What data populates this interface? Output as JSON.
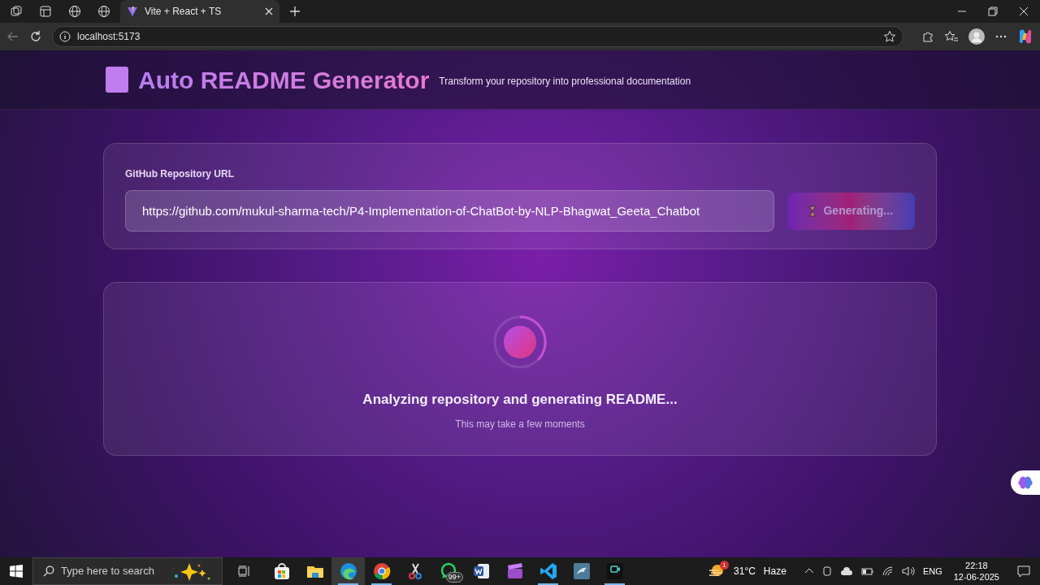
{
  "browser": {
    "tab": {
      "title": "Vite + React + TS",
      "selected": true
    },
    "address": "localhost:5173"
  },
  "header": {
    "title": "Auto README Generator",
    "subtitle": "Transform your repository into professional documentation"
  },
  "form": {
    "label": "GitHub Repository URL",
    "url": "https://github.com/mukul-sharma-tech/P4-Implementation-of-ChatBot-by-NLP-Bhagwat_Geeta_Chatbot",
    "button": {
      "label": "Generating...",
      "disabled": true
    }
  },
  "loading": {
    "title": "Analyzing repository and generating README...",
    "subtitle": "This may take a few moments"
  },
  "taskbar": {
    "search_placeholder": "Type here to search",
    "apps": [
      {
        "kind": "store",
        "open": false,
        "selected": false
      },
      {
        "kind": "folder",
        "open": false,
        "selected": false
      },
      {
        "kind": "edge",
        "open": true,
        "selected": true
      },
      {
        "kind": "chrome",
        "open": true,
        "selected": false
      },
      {
        "kind": "scissors",
        "open": false,
        "selected": false
      },
      {
        "kind": "whatsapp",
        "open": false,
        "selected": false,
        "badge": "99+"
      },
      {
        "kind": "word",
        "open": false,
        "selected": false
      },
      {
        "kind": "clapper",
        "open": false,
        "selected": false
      },
      {
        "kind": "vscode",
        "open": true,
        "selected": false
      },
      {
        "kind": "dolphin",
        "open": false,
        "selected": false
      },
      {
        "kind": "recorder",
        "open": true,
        "selected": false
      }
    ],
    "weather": {
      "badge": "1",
      "temp": "31°C",
      "condition": "Haze"
    },
    "language": "ENG",
    "time": "22:18",
    "date": "12-06-2025"
  }
}
